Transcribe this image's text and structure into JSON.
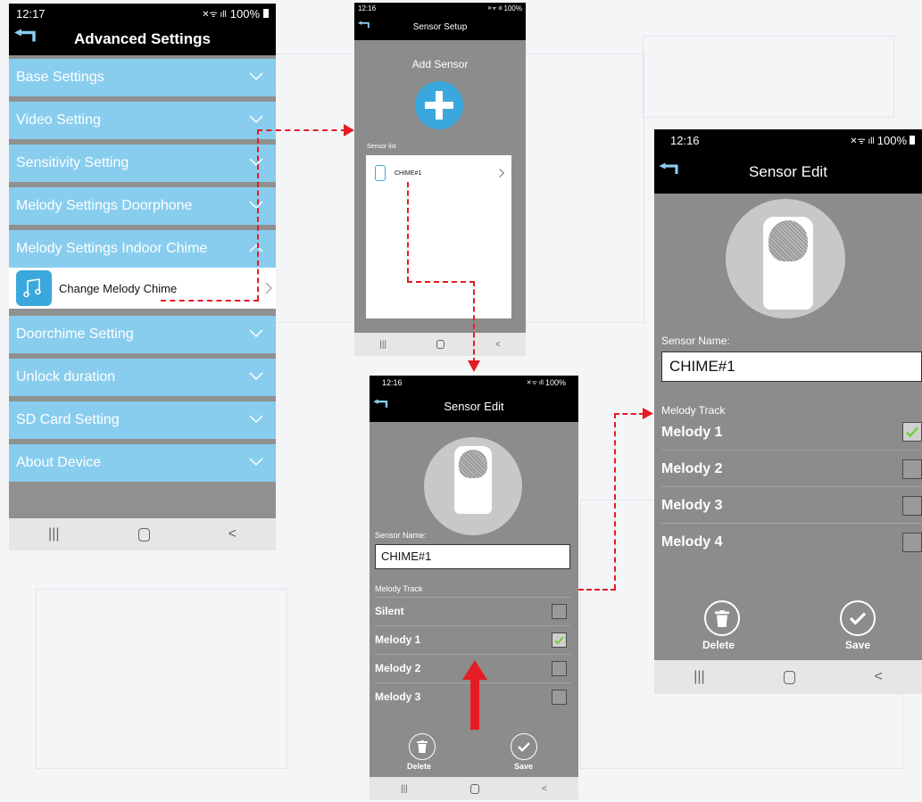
{
  "advanced": {
    "time": "12:17",
    "battery": "100%",
    "title": "Advanced Settings",
    "sections": [
      {
        "label": "Base Settings"
      },
      {
        "label": "Video Setting"
      },
      {
        "label": "Sensitivity Setting"
      },
      {
        "label": "Melody Settings Doorphone"
      },
      {
        "label": "Melody Settings Indoor Chime"
      },
      {
        "label": "Doorchime Setting"
      },
      {
        "label": "Unlock duration"
      },
      {
        "label": "SD Card Setting"
      },
      {
        "label": "About Device"
      }
    ],
    "sub_item": "Change Melody Chime"
  },
  "setup": {
    "time": "12:16",
    "battery": "100%",
    "title": "Sensor Setup",
    "add_label": "Add Sensor",
    "list_label": "Sensor list",
    "sensor_name": "CHIME#1"
  },
  "edit_small": {
    "time": "12:16",
    "battery": "100%",
    "title": "Sensor Edit",
    "name_label": "Sensor Name:",
    "name_value": "CHIME#1",
    "track_label": "Melody Track",
    "tracks": [
      {
        "label": "Silent",
        "checked": false
      },
      {
        "label": "Melody 1",
        "checked": true
      },
      {
        "label": "Melody 2",
        "checked": false
      },
      {
        "label": "Melody 3",
        "checked": false
      }
    ],
    "delete_label": "Delete",
    "save_label": "Save"
  },
  "edit_large": {
    "time": "12:16",
    "battery": "100%",
    "title": "Sensor Edit",
    "name_label": "Sensor Name:",
    "name_value": "CHIME#1",
    "track_label": "Melody Track",
    "tracks": [
      {
        "label": "Melody 1",
        "checked": true
      },
      {
        "label": "Melody 2",
        "checked": false
      },
      {
        "label": "Melody 3",
        "checked": false
      },
      {
        "label": "Melody 4",
        "checked": false
      }
    ],
    "delete_label": "Delete",
    "save_label": "Save"
  },
  "colors": {
    "accordion": "#89cdee",
    "screen_bg": "#8c8c8c",
    "add_button": "#3aa8dc",
    "arrow": "#e51c23",
    "check": "#6fcf3a"
  }
}
